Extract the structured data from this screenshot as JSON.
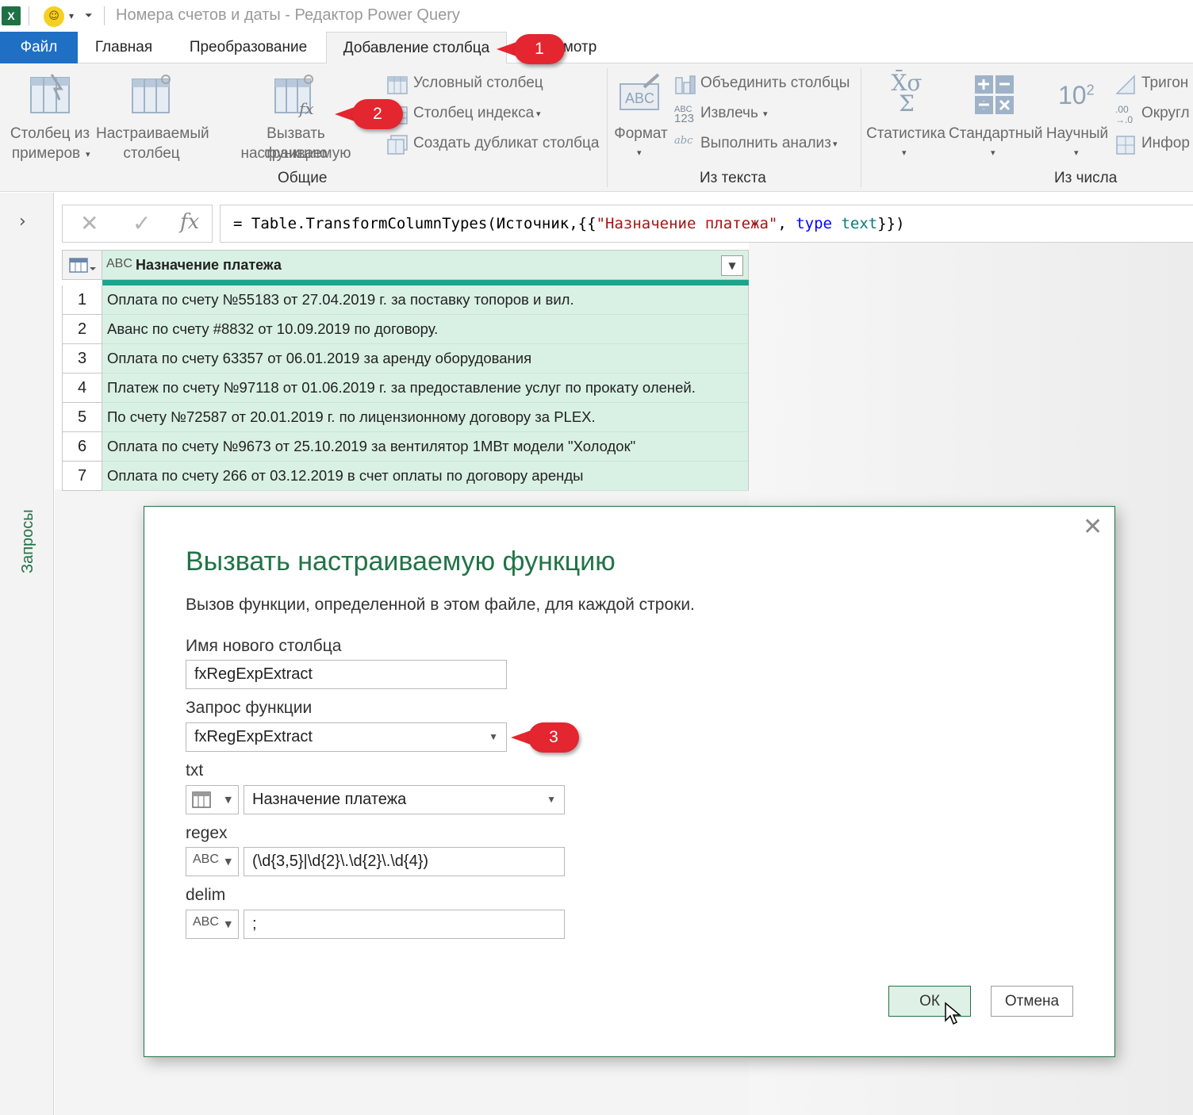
{
  "window": {
    "app_icon": "excel-icon",
    "title": "Номера счетов и даты - Редактор Power Query"
  },
  "tabs": [
    {
      "label": "Файл"
    },
    {
      "label": "Главная"
    },
    {
      "label": "Преобразование"
    },
    {
      "label": "Добавление столбца"
    },
    {
      "label": "осмотр"
    }
  ],
  "ribbon": {
    "general": {
      "group_label": "Общие",
      "column_from_examples": {
        "line1": "Столбец из",
        "line2": "примеров"
      },
      "custom_column": {
        "line1": "Настраиваемый",
        "line2": "столбец"
      },
      "invoke_function": {
        "line1": "Вызвать настраиваемую",
        "line2": "функцию"
      },
      "conditional_column": "Условный столбец",
      "index_column": "Столбец индекса",
      "duplicate_column": "Создать дубликат столбца"
    },
    "from_text": {
      "group_label": "Из текста",
      "format": "Формат",
      "merge_columns": "Объединить столбцы",
      "extract": "Извлечь",
      "parse": "Выполнить анализ"
    },
    "from_number": {
      "group_label": "Из числа",
      "statistics": "Статистика",
      "standard": "Стандартный",
      "scientific": "Научный",
      "scientific_icon_text": "10",
      "scientific_icon_sup": "2",
      "trig": "Тригон",
      "rounding": "Округл",
      "info": "Инфор"
    }
  },
  "queries_pane": {
    "label": "Запросы"
  },
  "formula": {
    "prefix": "= Table.TransformColumnTypes(Источник,{{",
    "string": "\"Назначение платежа\"",
    "sep": ", ",
    "keyword": "type",
    "type_name": "text",
    "suffix": "}})"
  },
  "grid": {
    "column_header": "Назначение платежа",
    "column_type": "ABC",
    "rows": [
      {
        "n": "1",
        "value": "Оплата по счету №55183 от 27.04.2019 г. за поставку топоров и вил."
      },
      {
        "n": "2",
        "value": "Аванс по счету #8832 от 10.09.2019 по договору."
      },
      {
        "n": "3",
        "value": "Оплата по счету 63357 от 06.01.2019 за аренду оборудования"
      },
      {
        "n": "4",
        "value": "Платеж по счету №97118 от 01.06.2019 г. за предоставление услуг по прокату оленей."
      },
      {
        "n": "5",
        "value": "По счету №72587 от 20.01.2019 г. по лицензионному договору за PLEX."
      },
      {
        "n": "6",
        "value": "Оплата по счету №9673 от 25.10.2019 за вентилятор 1МВт модели \"Холодок\""
      },
      {
        "n": "7",
        "value": "Оплата по счету 266 от 03.12.2019 в счет оплаты по договору аренды"
      }
    ]
  },
  "dialog": {
    "title": "Вызвать настраиваемую функцию",
    "description": "Вызов функции, определенной в этом файле, для каждой строки.",
    "new_column_label": "Имя нового столбца",
    "new_column_value": "fxRegExpExtract",
    "function_query_label": "Запрос функции",
    "function_query_value": "fxRegExpExtract",
    "txt_label": "txt",
    "txt_value": "Назначение платежа",
    "regex_label": "regex",
    "regex_value": "(\\d{3,5}|\\d{2}\\.\\d{2}\\.\\d{4})",
    "delim_label": "delim",
    "delim_value": ";",
    "ok": "ОК",
    "cancel": "Отмена"
  },
  "callouts": [
    "1",
    "2",
    "3"
  ],
  "colors": {
    "accent_green": "#217346",
    "file_tab_blue": "#1f6fc5",
    "callout_red": "#e3262f",
    "grid_cell_green": "#d9f1e4"
  }
}
